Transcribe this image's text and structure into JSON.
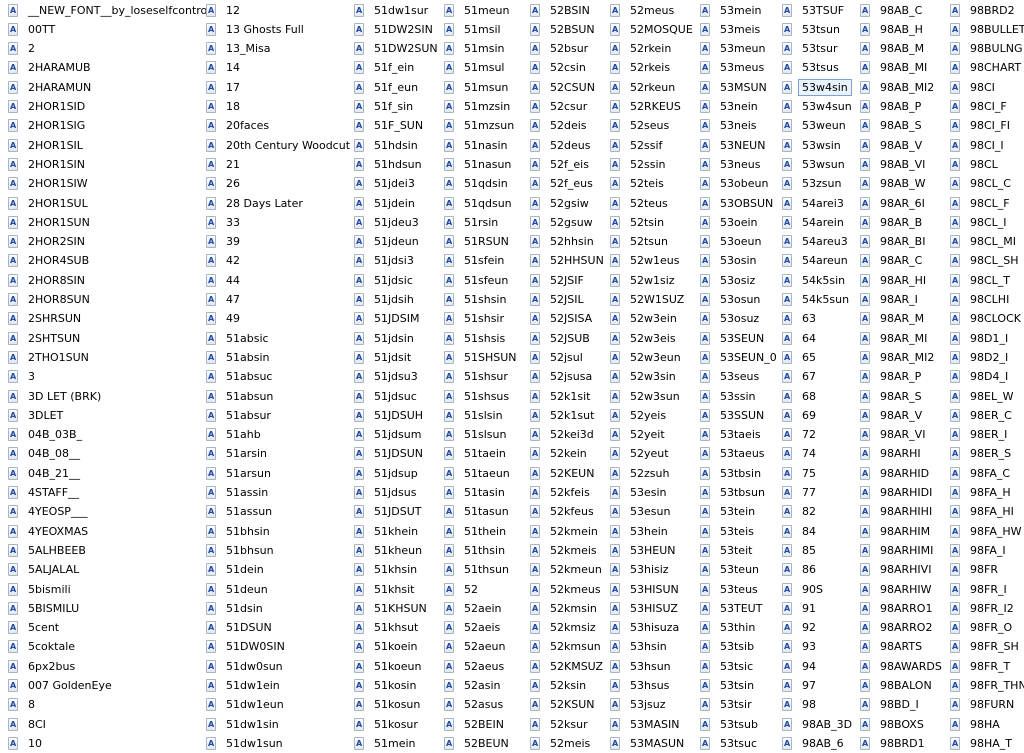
{
  "window": {
    "title": ""
  },
  "columns": [
    [
      "__NEW_FONT__by_loseselfcontrol",
      "00TT",
      "2",
      "2HARAMUB",
      "2HARAMUN",
      "2HOR1SID",
      "2HOR1SIG",
      "2HOR1SIL",
      "2HOR1SIN",
      "2HOR1SIW",
      "2HOR1SUL",
      "2HOR1SUN",
      "2HOR2SIN",
      "2HOR4SUB",
      "2HOR8SIN",
      "2HOR8SUN",
      "2SHRSUN",
      "2SHTSUN",
      "2THO1SUN",
      "3",
      "3D LET (BRK)",
      "3DLET",
      "04B_03B_",
      "04B_08__",
      "04B_21__",
      "4STAFF__",
      "4YEOSP___",
      "4YEOXMAS",
      "5ALHBEEB",
      "5ALJALAL",
      "5bismili",
      "5BISMILU",
      "5cent",
      "5coktale",
      "6px2bus",
      "007 GoldenEye",
      "8",
      "8CI",
      "10"
    ],
    [
      "12",
      "13 Ghosts Full",
      "13_Misa",
      "14",
      "17",
      "18",
      "20faces",
      "20th Century Woodcut",
      "21",
      "26",
      "28 Days Later",
      "33",
      "39",
      "42",
      "44",
      "47",
      "49",
      "51absic",
      "51absin",
      "51absuc",
      "51absun",
      "51absur",
      "51ahb",
      "51arsin",
      "51arsun",
      "51assin",
      "51assun",
      "51bhsin",
      "51bhsun",
      "51dein",
      "51deun",
      "51dsin",
      "51DSUN",
      "51DW0SIN",
      "51dw0sun",
      "51dw1ein",
      "51dw1eun",
      "51dw1sin",
      "51dw1sun"
    ],
    [
      "51dw1sur",
      "51DW2SIN",
      "51DW2SUN",
      "51f_ein",
      "51f_eun",
      "51f_sin",
      "51F_SUN",
      "51hdsin",
      "51hdsun",
      "51jdei3",
      "51jdein",
      "51jdeu3",
      "51jdeun",
      "51jdsi3",
      "51jdsic",
      "51jdsih",
      "51JDSIM",
      "51jdsin",
      "51jdsit",
      "51jdsu3",
      "51jdsuc",
      "51JDSUH",
      "51jdsum",
      "51JDSUN",
      "51jdsup",
      "51jdsus",
      "51JDSUT",
      "51khein",
      "51kheun",
      "51khsin",
      "51khsit",
      "51KHSUN",
      "51khsut",
      "51koein",
      "51koeun",
      "51kosin",
      "51kosun",
      "51kosur",
      "51mein"
    ],
    [
      "51meun",
      "51msil",
      "51msin",
      "51msul",
      "51msun",
      "51mzsin",
      "51mzsun",
      "51nasin",
      "51nasun",
      "51qdsin",
      "51qdsun",
      "51rsin",
      "51RSUN",
      "51sfein",
      "51sfeun",
      "51shsin",
      "51shsir",
      "51shsis",
      "51SHSUN",
      "51shsur",
      "51shsus",
      "51slsin",
      "51slsun",
      "51taein",
      "51taeun",
      "51tasin",
      "51tasun",
      "51thein",
      "51thsin",
      "51thsun",
      "52",
      "52aein",
      "52aeis",
      "52aeun",
      "52aeus",
      "52asin",
      "52asus",
      "52BEIN",
      "52BEUN"
    ],
    [
      "52BSIN",
      "52BSUN",
      "52bsur",
      "52csin",
      "52CSUN",
      "52csur",
      "52deis",
      "52deus",
      "52f_eis",
      "52f_eus",
      "52gsiw",
      "52gsuw",
      "52hhsin",
      "52HHSUN",
      "52JSIF",
      "52JSIL",
      "52JSISA",
      "52JSUB",
      "52jsul",
      "52jsusa",
      "52k1sit",
      "52k1sut",
      "52kei3d",
      "52kein",
      "52KEUN",
      "52kfeis",
      "52kfeus",
      "52kmein",
      "52kmeis",
      "52kmeun",
      "52kmeus",
      "52kmsin",
      "52kmsiz",
      "52kmsun",
      "52KMSUZ",
      "52ksin",
      "52KSUN",
      "52ksur",
      "52meis"
    ],
    [
      "52meus",
      "52MOSQUE",
      "52rkein",
      "52rkeis",
      "52rkeun",
      "52RKEUS",
      "52seus",
      "52ssif",
      "52ssin",
      "52teis",
      "52teus",
      "52tsin",
      "52tsun",
      "52w1eus",
      "52w1siz",
      "52W1SUZ",
      "52w3ein",
      "52w3eis",
      "52w3eun",
      "52w3sin",
      "52w3sun",
      "52yeis",
      "52yeit",
      "52yeut",
      "52zsuh",
      "53esin",
      "53esun",
      "53hein",
      "53HEUN",
      "53hisiz",
      "53HISUN",
      "53HISUZ",
      "53hisuza",
      "53hsin",
      "53hsun",
      "53hsus",
      "53jsuz",
      "53MASIN",
      "53MASUN"
    ],
    [
      "53mein",
      "53meis",
      "53meun",
      "53meus",
      "53MSUN",
      "53nein",
      "53neis",
      "53NEUN",
      "53neus",
      "53obeun",
      "53OBSUN",
      "53oein",
      "53oeun",
      "53osin",
      "53osiz",
      "53osun",
      "53osuz",
      "53SEUN",
      "53SEUN_0",
      "53seus",
      "53ssin",
      "53SSUN",
      "53taeis",
      "53taeus",
      "53tbsin",
      "53tbsun",
      "53tein",
      "53teis",
      "53teit",
      "53teun",
      "53teus",
      "53TEUT",
      "53thin",
      "53tsib",
      "53tsic",
      "53tsin",
      "53tsir",
      "53tsub",
      "53tsuc"
    ],
    [
      "53TSUF",
      "53tsun",
      "53tsur",
      "53tsus",
      "53w4sin",
      "53w4sun",
      "53weun",
      "53wsin",
      "53wsun",
      "53zsun",
      "54arei3",
      "54arein",
      "54areu3",
      "54areun",
      "54k5sin",
      "54k5sun",
      "63",
      "64",
      "65",
      "67",
      "68",
      "69",
      "72",
      "74",
      "75",
      "77",
      "82",
      "84",
      "85",
      "86",
      "90S",
      "91",
      "92",
      "93",
      "94",
      "97",
      "98",
      "98AB_3D",
      "98AB_6"
    ],
    [
      "98AB_C",
      "98AB_H",
      "98AB_M",
      "98AB_MI",
      "98AB_MI2",
      "98AB_P",
      "98AB_S",
      "98AB_V",
      "98AB_VI",
      "98AB_W",
      "98AR_6I",
      "98AR_B",
      "98AR_BI",
      "98AR_C",
      "98AR_HI",
      "98AR_I",
      "98AR_M",
      "98AR_MI",
      "98AR_MI2",
      "98AR_P",
      "98AR_S",
      "98AR_V",
      "98AR_VI",
      "98ARHI",
      "98ARHID",
      "98ARHIDI",
      "98ARHIHI",
      "98ARHIM",
      "98ARHIMI",
      "98ARHIVI",
      "98ARHIW",
      "98ARRO1",
      "98ARRO2",
      "98ARTS",
      "98AWARDS",
      "98BALON",
      "98BD_I",
      "98BOXS",
      "98BRD1"
    ],
    [
      "98BRD2",
      "98BULLET",
      "98BULNG",
      "98CHART",
      "98CI",
      "98CI_F",
      "98CI_FI",
      "98CI_I",
      "98CL",
      "98CL_C",
      "98CL_F",
      "98CL_I",
      "98CL_MI",
      "98CL_SH",
      "98CL_T",
      "98CLHI",
      "98CLOCK",
      "98D1_I",
      "98D2_I",
      "98D4_I",
      "98EL_W",
      "98ER_C",
      "98ER_I",
      "98ER_S",
      "98FA_C",
      "98FA_H",
      "98FA_HI",
      "98FA_HW",
      "98FA_I",
      "98FR",
      "98FR_I",
      "98FR_I2",
      "98FR_O",
      "98FR_SH",
      "98FR_T",
      "98FR_THN",
      "98FURN",
      "98HA",
      "98HA_T"
    ]
  ],
  "selected": {
    "column": 7,
    "row": 4
  }
}
